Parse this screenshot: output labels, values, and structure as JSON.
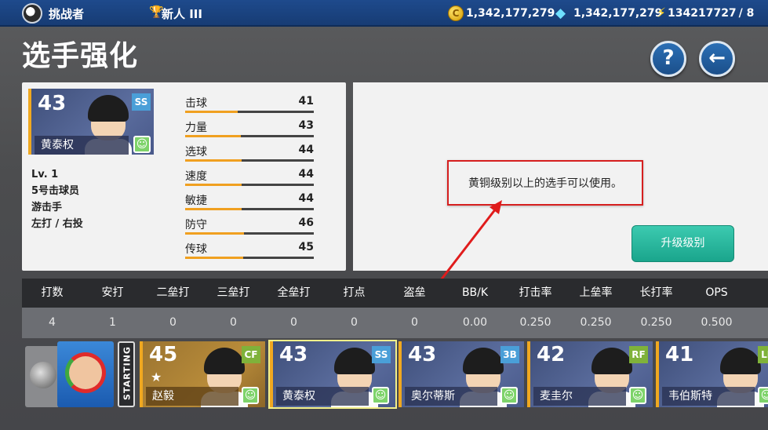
{
  "topbar": {
    "team_name": "挑战者",
    "rank_label": "新人 III",
    "coins": "1,342,177,279",
    "gems": "1,342,177,279",
    "energy": "134217727",
    "energy_max": "/ 8",
    "icons": [
      "team-logo-icon",
      "trophy-icon",
      "coin-icon",
      "gem-icon",
      "bolt-icon"
    ]
  },
  "page_title": "选手强化",
  "help_label": "?",
  "back_label": "←",
  "player": {
    "number": "43",
    "position": "SS",
    "name": "黄泰权",
    "level": "Lv. 1",
    "order": "5号击球员",
    "field_position": "游击手",
    "bats_throws": "左打 / 右投",
    "stats": [
      {
        "label": "击球",
        "value": "41",
        "fill": 0.41
      },
      {
        "label": "力量",
        "value": "43",
        "fill": 0.43
      },
      {
        "label": "选球",
        "value": "44",
        "fill": 0.44
      },
      {
        "label": "速度",
        "value": "44",
        "fill": 0.44
      },
      {
        "label": "敏捷",
        "value": "44",
        "fill": 0.44
      },
      {
        "label": "防守",
        "value": "46",
        "fill": 0.46
      },
      {
        "label": "传球",
        "value": "45",
        "fill": 0.45
      }
    ]
  },
  "notice": "黄铜级别以上的选手可以使用。",
  "upgrade_button": "升级级别",
  "stat_table": {
    "headers": [
      "打数",
      "安打",
      "二垒打",
      "三垒打",
      "全垒打",
      "打点",
      "盗垒",
      "BB/K",
      "打击率",
      "上垒率",
      "长打率",
      "OPS"
    ],
    "values": [
      "4",
      "1",
      "0",
      "0",
      "0",
      "0",
      "0",
      "0.00",
      "0.250",
      "0.250",
      "0.250",
      "0.500"
    ]
  },
  "roster": {
    "starting_label": "STARTING",
    "cards": [
      {
        "number": "45",
        "position": "CF",
        "name": "赵毅",
        "style": "gold",
        "pos_color": "#7fb23a",
        "star": "★"
      },
      {
        "number": "43",
        "position": "SS",
        "name": "黄泰权",
        "style": "blue",
        "pos_color": "#4a9fd8",
        "selected": true
      },
      {
        "number": "43",
        "position": "3B",
        "name": "奥尔蒂斯",
        "style": "blue",
        "pos_color": "#4a9fd8"
      },
      {
        "number": "42",
        "position": "RF",
        "name": "麦圭尔",
        "style": "blue",
        "pos_color": "#7fb23a"
      },
      {
        "number": "41",
        "position": "LF",
        "name": "韦伯斯特",
        "style": "blue",
        "pos_color": "#7fb23a"
      }
    ]
  },
  "colors": {
    "accent_orange": "#f0a020",
    "upgrade_teal": "#1aa58c",
    "notice_red": "#d61f1f",
    "topbar_blue": "#1e4a8c"
  }
}
